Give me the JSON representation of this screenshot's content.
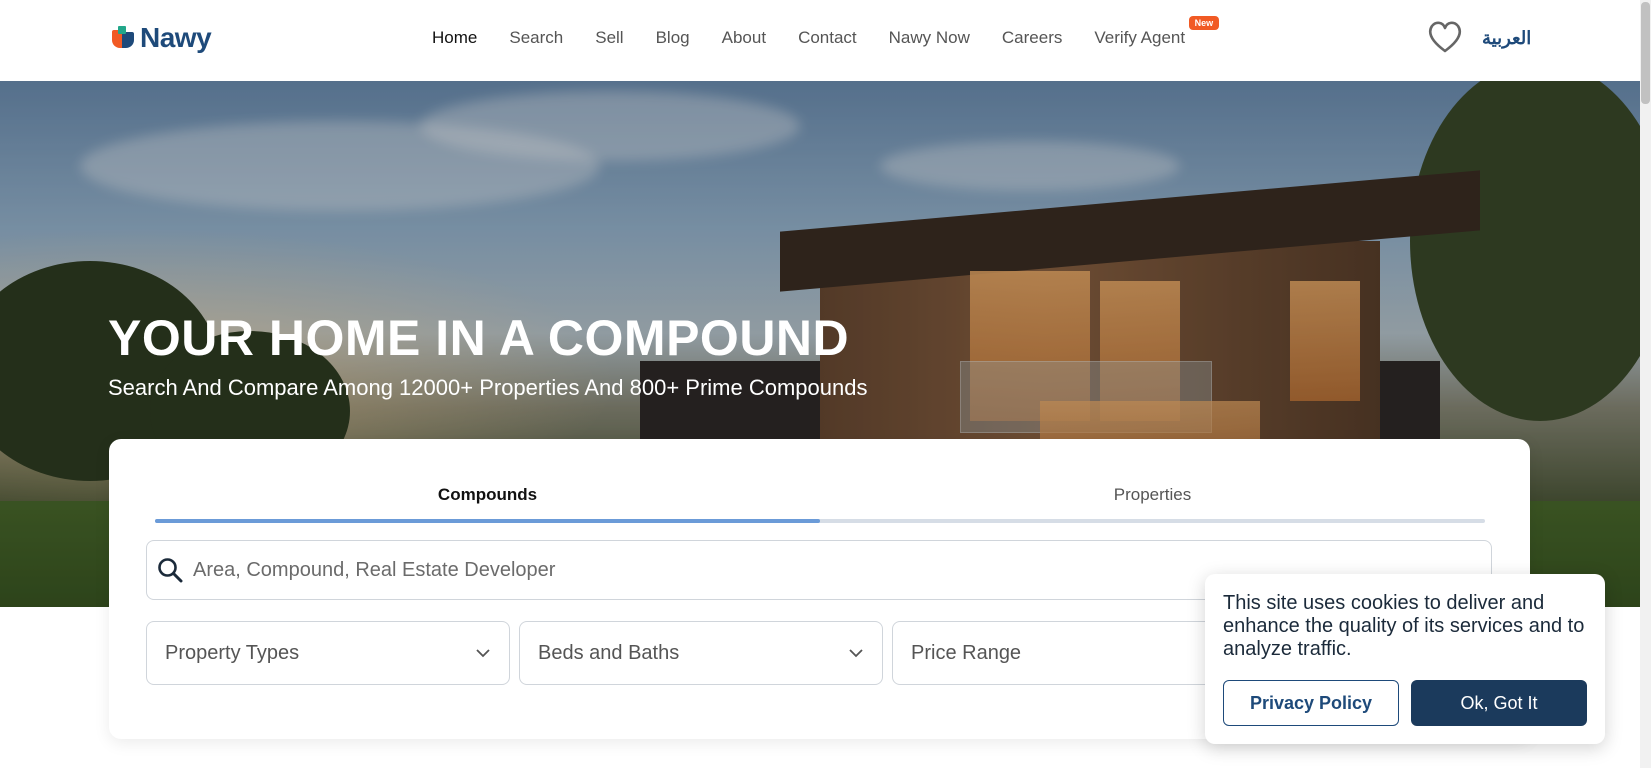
{
  "header": {
    "logo_text": "Nawy",
    "nav": [
      {
        "label": "Home",
        "active": true
      },
      {
        "label": "Search",
        "active": false
      },
      {
        "label": "Sell",
        "active": false
      },
      {
        "label": "Blog",
        "active": false
      },
      {
        "label": "About",
        "active": false
      },
      {
        "label": "Contact",
        "active": false
      },
      {
        "label": "Nawy Now",
        "active": false
      },
      {
        "label": "Careers",
        "active": false
      },
      {
        "label": "Verify Agent",
        "active": false,
        "badge": "New"
      }
    ],
    "favorites_icon": "heart-icon",
    "language_label": "العربية"
  },
  "hero": {
    "title": "YOUR HOME IN A COMPOUND",
    "subtitle": "Search And Compare Among 12000+ Properties And 800+ Prime Compounds"
  },
  "search": {
    "tabs": [
      {
        "label": "Compounds",
        "active": true
      },
      {
        "label": "Properties",
        "active": false
      }
    ],
    "placeholder": "Area, Compound, Real Estate Developer",
    "filters": [
      {
        "label": "Property Types"
      },
      {
        "label": "Beds and Baths"
      },
      {
        "label": "Price Range"
      }
    ]
  },
  "cookie": {
    "message": "This site uses cookies to deliver and enhance the quality of its services and to analyze traffic.",
    "privacy_label": "Privacy Policy",
    "ok_label": "Ok, Got It"
  },
  "colors": {
    "brand_navy": "#1e4a7a",
    "brand_orange": "#f15a24",
    "tab_active_line": "#6b9bd8",
    "ok_button": "#1b3a5c"
  }
}
